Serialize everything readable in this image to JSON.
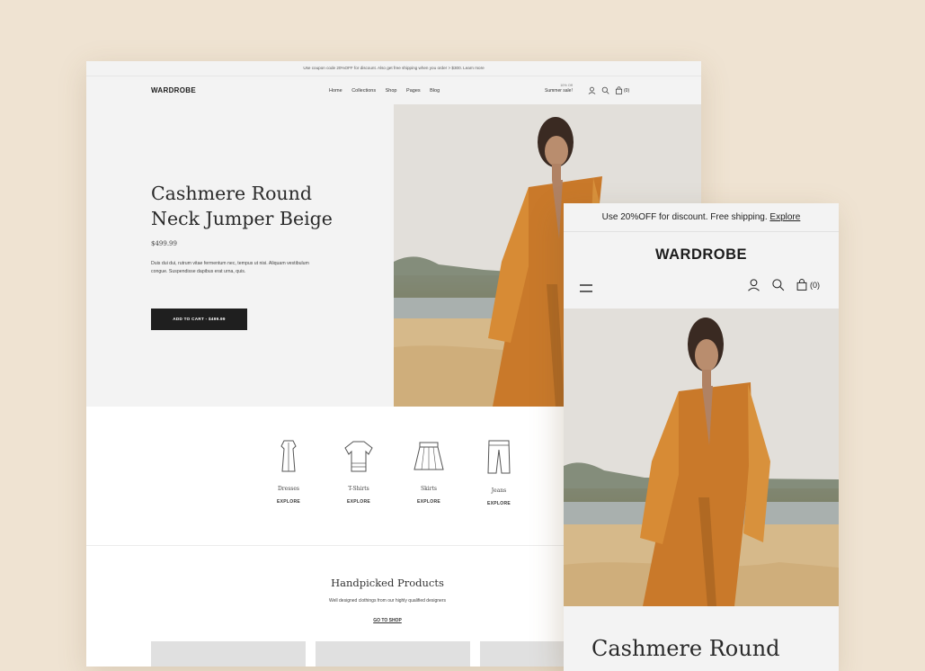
{
  "colors": {
    "background": "#efe3d2",
    "dress": "#c9792a",
    "button": "#1f1f1f"
  },
  "desktop": {
    "announcement": "Use coupon code 20%OFF for discount. Also get free shipping when you order > $300. Learn more",
    "logo": "WARDROBE",
    "nav": [
      "Home",
      "Collections",
      "Shop",
      "Pages",
      "Blog"
    ],
    "sale_small": "10% Off",
    "sale_label": "Summer sale!",
    "cart_count": "(0)",
    "hero": {
      "title_line1": "Cashmere Round",
      "title_line2": "Neck Jumper Beige",
      "price": "$499.99",
      "description": "Duis dui dui, rutrum vitae fermentum nec, tempus ut nisi. Aliquam vestibulum congue. Suspendisse dapibus erat urna, quis.",
      "button": "ADD TO CART - $499.99"
    },
    "categories": [
      {
        "name": "Dresses",
        "link": "EXPLORE",
        "icon": "dress-icon"
      },
      {
        "name": "T-Shirts",
        "link": "EXPLORE",
        "icon": "tshirt-icon"
      },
      {
        "name": "Skirts",
        "link": "EXPLORE",
        "icon": "skirt-icon"
      },
      {
        "name": "Jeans",
        "link": "EXPLORE",
        "icon": "jeans-icon"
      }
    ],
    "handpicked": {
      "title": "Handpicked Products",
      "subtitle": "Well designed clothings from our highly qualified designers",
      "link": "GO TO SHOP"
    }
  },
  "mobile": {
    "announcement_text": "Use 20%OFF for discount. Free shipping.",
    "announcement_link": "Explore",
    "logo": "WARDROBE",
    "cart_count": "(0)",
    "title": "Cashmere Round"
  }
}
